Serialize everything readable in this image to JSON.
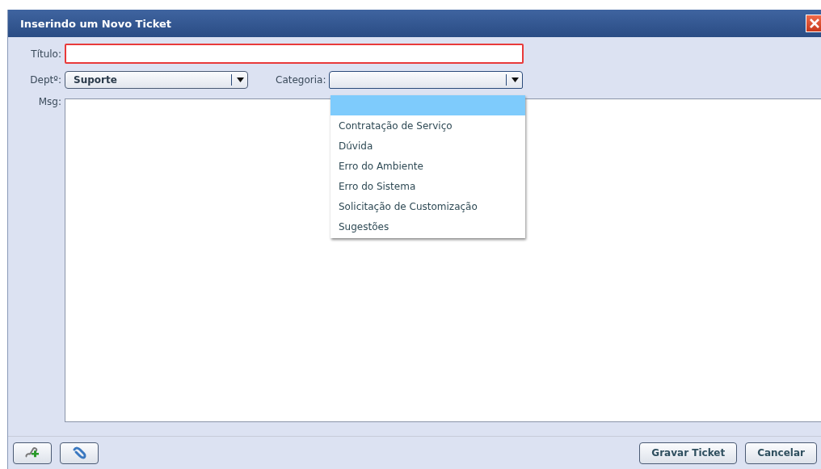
{
  "window": {
    "title": "Inserindo um Novo Ticket"
  },
  "form": {
    "titulo": {
      "label": "Título:",
      "invalid": true
    },
    "dept": {
      "label": "Deptº:",
      "value": "Suporte"
    },
    "categoria": {
      "label": "Categoria:",
      "expanded": true,
      "options": [
        {
          "selected": true
        },
        {
          "label": "Contratação de Serviço",
          "selected": false
        },
        {
          "label": "Dúvida",
          "selected": false
        },
        {
          "label": "Erro do Ambiente",
          "selected": false
        },
        {
          "label": "Erro do Sistema",
          "selected": false
        },
        {
          "label": "Solicitação de Customização",
          "selected": false
        },
        {
          "label": "Sugestões",
          "selected": false
        }
      ]
    },
    "msg": {
      "label": "Msg:"
    }
  },
  "footer": {
    "left_buttons": [
      {
        "kind": "add-link"
      },
      {
        "kind": "attach"
      }
    ],
    "right_buttons": [
      "Gravar Ticket",
      "Cancelar"
    ]
  }
}
